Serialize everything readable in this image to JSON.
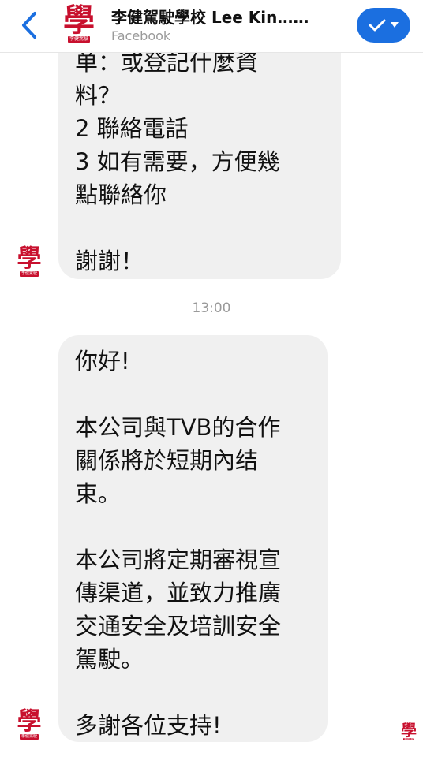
{
  "header": {
    "title": "李健駕駛學校 Lee Kin……",
    "subtitle": "Facebook",
    "back_icon": "chevron-left-icon",
    "action_icon": "checkmark-icon",
    "accent_color": "#1b6fe0"
  },
  "logo": {
    "char": "學",
    "sub": "李健駕駛",
    "color": "#c8102e"
  },
  "messages": [
    {
      "lines": [
        "单：或登記什麼資",
        "料？",
        "2 聯絡電話",
        "3 如有需要，方便幾",
        "點聯絡你",
        "",
        "謝謝！"
      ]
    },
    {
      "lines": [
        "你好!",
        "",
        "本公司與TVB的合作",
        "關係將於短期內结",
        "束。",
        "",
        "本公司將定期審視宣",
        "傳渠道，並致力推廣",
        "交通安全及培訓安全",
        "駕駛。",
        "",
        "多謝各位支持!"
      ]
    }
  ],
  "timestamp": "13:00"
}
